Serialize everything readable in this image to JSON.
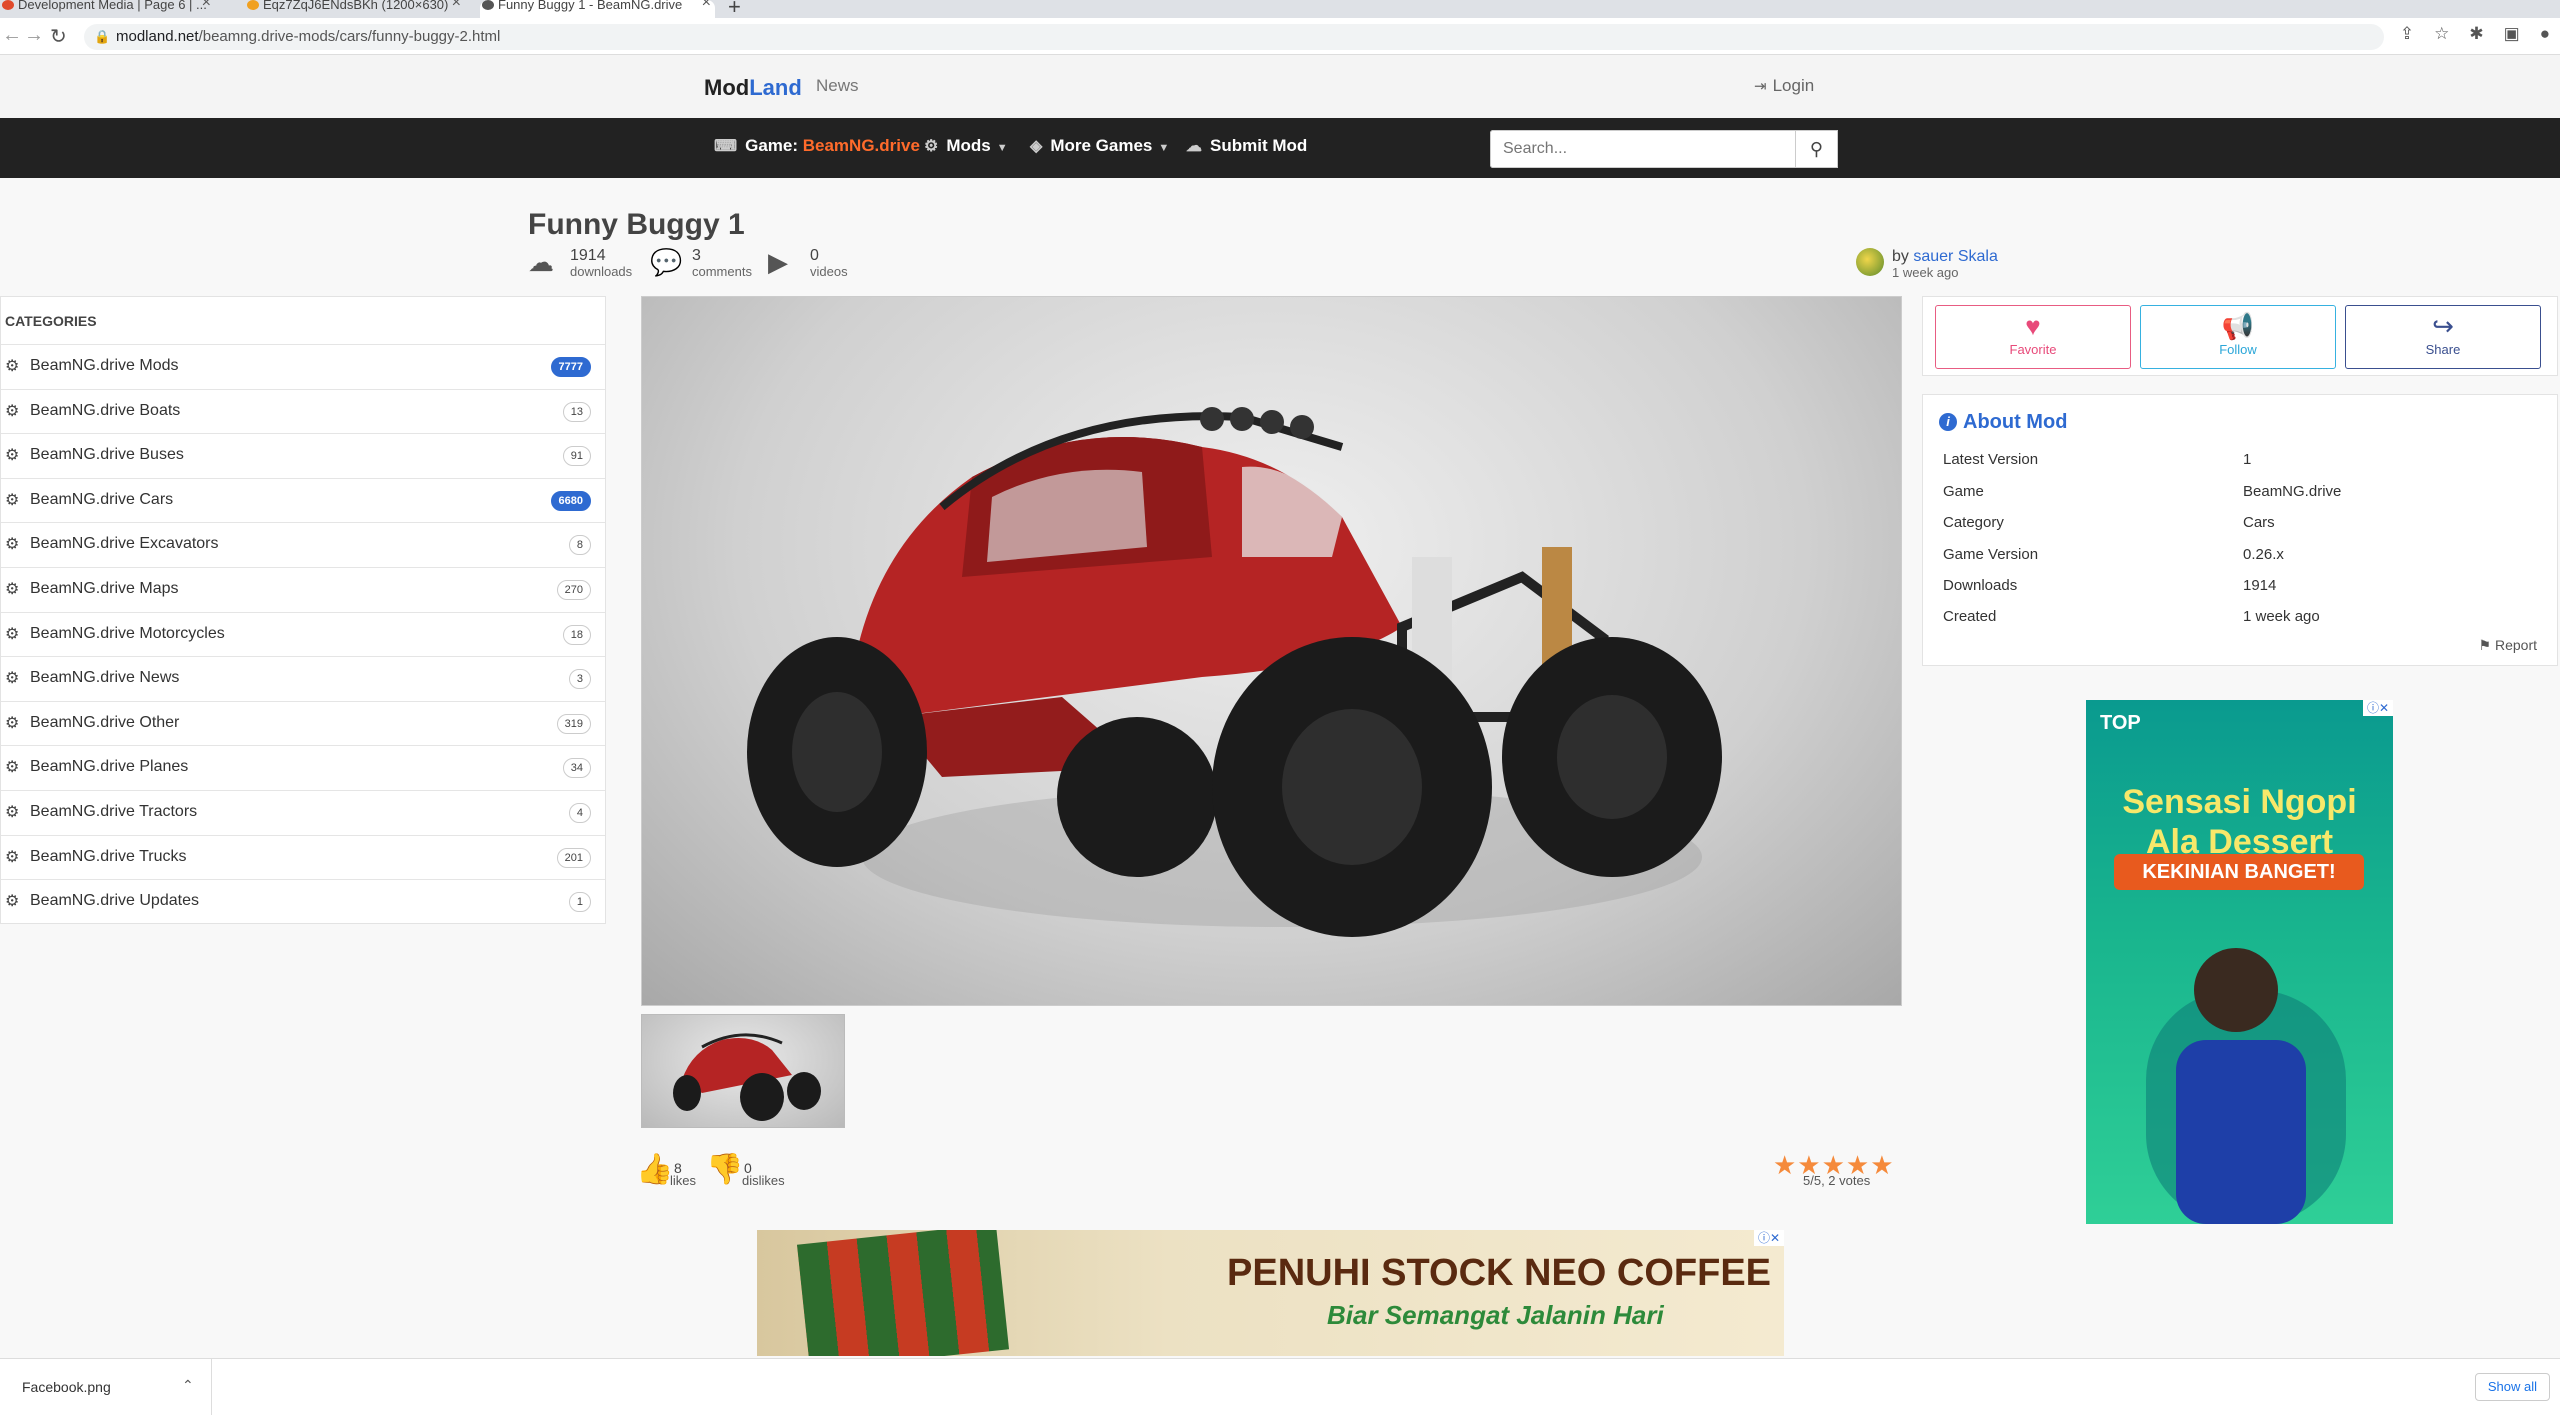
{
  "browser": {
    "tabs": [
      {
        "label": "Development Media | Page 6 | ..."
      },
      {
        "label": "Eqz7ZqJ6ENdsBKh (1200×630)"
      },
      {
        "label": "Funny Buggy 1 - BeamNG.drive"
      }
    ],
    "url_host": "modland.net",
    "url_path": "/beamng.drive-mods/cars/funny-buggy-2.html"
  },
  "site": {
    "logo_mod": "Mod",
    "logo_land": "Land",
    "news": "News",
    "login": "Login"
  },
  "nav": {
    "game_label": "Game:",
    "game_value": "BeamNG.drive",
    "mods": "Mods",
    "more_games": "More Games",
    "submit": "Submit Mod",
    "search_placeholder": "Search..."
  },
  "mod": {
    "title": "Funny Buggy 1",
    "downloads": "1914",
    "downloads_label": "downloads",
    "comments": "3",
    "comments_label": "comments",
    "videos": "0",
    "videos_label": "videos",
    "by": "by",
    "author": "sauer Skala",
    "posted": "1 week ago",
    "likes": "8",
    "likes_label": "likes",
    "dislikes": "0",
    "dislikes_label": "dislikes",
    "stars": "★★★★★",
    "rating_text": "5/5, 2 votes"
  },
  "sidebar": {
    "heading": "CATEGORIES",
    "items": [
      {
        "label": "BeamNG.drive Mods",
        "count": "7777"
      },
      {
        "label": "BeamNG.drive Boats",
        "count": "13"
      },
      {
        "label": "BeamNG.drive Buses",
        "count": "91"
      },
      {
        "label": "BeamNG.drive Cars",
        "count": "6680"
      },
      {
        "label": "BeamNG.drive Excavators",
        "count": "8"
      },
      {
        "label": "BeamNG.drive Maps",
        "count": "270"
      },
      {
        "label": "BeamNG.drive Motorcycles",
        "count": "18"
      },
      {
        "label": "BeamNG.drive News",
        "count": "3"
      },
      {
        "label": "BeamNG.drive Other",
        "count": "319"
      },
      {
        "label": "BeamNG.drive Planes",
        "count": "34"
      },
      {
        "label": "BeamNG.drive Tractors",
        "count": "4"
      },
      {
        "label": "BeamNG.drive Trucks",
        "count": "201"
      },
      {
        "label": "BeamNG.drive Updates",
        "count": "1"
      }
    ]
  },
  "actions": {
    "favorite": "Favorite",
    "follow": "Follow",
    "share": "Share"
  },
  "about": {
    "title": "About Mod",
    "rows": [
      {
        "key": "Latest Version",
        "value": "1"
      },
      {
        "key": "Game",
        "value": "BeamNG.drive"
      },
      {
        "key": "Category",
        "value": "Cars"
      },
      {
        "key": "Game Version",
        "value": "0.26.x"
      },
      {
        "key": "Downloads",
        "value": "1914"
      },
      {
        "key": "Created",
        "value": "1 week ago"
      }
    ],
    "report": "Report"
  },
  "ads": {
    "side_brand": "TOP",
    "side_line1": "Sensasi Ngopi",
    "side_line2": "Ala Dessert",
    "side_line3": "KEKINIAN BANGET!",
    "bottom_line1": "PENUHI STOCK NEO COFFEE",
    "bottom_line2": "Biar Semangat Jalanin Hari"
  },
  "downloads_bar": {
    "file": "Facebook.png",
    "show_all": "Show all"
  },
  "colors": {
    "accent": "#2e6ad1",
    "game_orange": "#ff6b2b",
    "navbar_bg": "#222222",
    "star": "#f58a3b",
    "favorite": "#e84a7a",
    "follow": "#2aa6d8",
    "share": "#3a4f8f"
  }
}
